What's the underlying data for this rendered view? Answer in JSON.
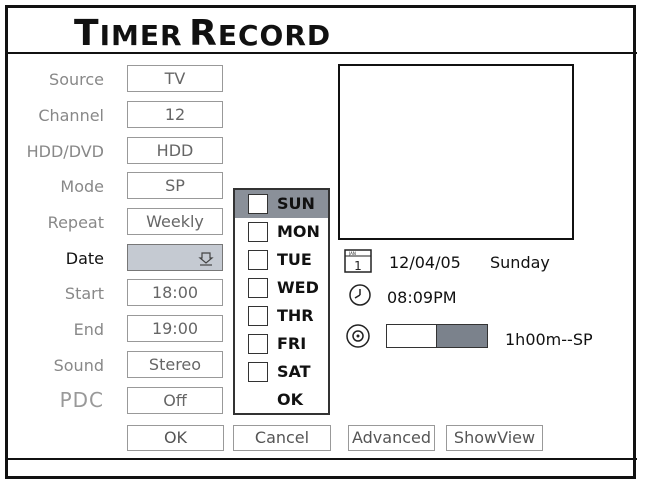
{
  "title": {
    "first_letter": "T",
    "first_rest": "IMER",
    "second_letter": "R",
    "second_rest": "ECORD"
  },
  "form": {
    "rows": [
      {
        "label": "Source",
        "value": "TV"
      },
      {
        "label": "Channel",
        "value": "12"
      },
      {
        "label": "HDD/DVD",
        "value": "HDD"
      },
      {
        "label": "Mode",
        "value": "SP"
      },
      {
        "label": "Repeat",
        "value": "Weekly"
      },
      {
        "label": "Date",
        "value": ""
      },
      {
        "label": "Start",
        "value": "18:00"
      },
      {
        "label": "End",
        "value": "19:00"
      },
      {
        "label": "Sound",
        "value": "Stereo"
      },
      {
        "label": "PDC",
        "value": "Off"
      }
    ]
  },
  "day_picker": {
    "days": [
      "SUN",
      "MON",
      "TUE",
      "WED",
      "THR",
      "FRI",
      "SAT"
    ],
    "highlighted": "SUN",
    "ok_label": "OK"
  },
  "buttons": {
    "ok": "OK",
    "cancel": "Cancel",
    "advanced": "Advanced",
    "showview": "ShowView"
  },
  "info": {
    "calendar_icon_text": "1",
    "date": "12/04/05",
    "weekday": "Sunday",
    "time": "08:09PM",
    "duration": "1h00m--SP",
    "space_used_fraction": 0.5
  },
  "icons": [
    "calendar-icon",
    "clock-icon",
    "disc-icon",
    "calendar-picker-icon"
  ],
  "colors": {
    "selected_field": "#c5cad2",
    "highlight_row": "#8a9099",
    "bar_fill": "#7b828c"
  }
}
